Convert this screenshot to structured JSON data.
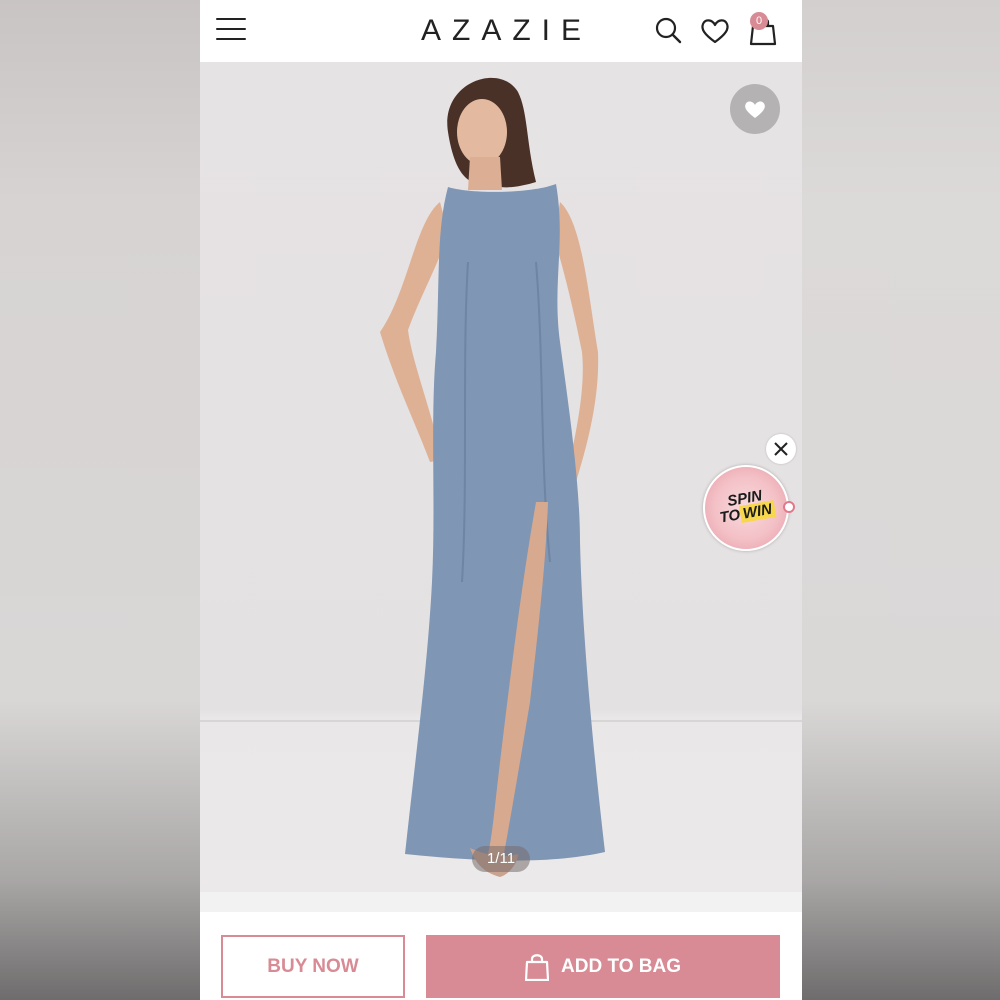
{
  "header": {
    "logo": "AZAZIE",
    "cart_count": "0"
  },
  "gallery": {
    "image_alt": "Model wearing a dusty blue sleeveless floor-length gown with high slit",
    "counter": "1/11"
  },
  "spin_widget": {
    "line1": "SPIN",
    "line2_to": "TO",
    "line2_win": "WIN"
  },
  "actions": {
    "buy_now_label": "BUY NOW",
    "add_to_bag_label": "ADD TO BAG"
  },
  "colors": {
    "accent": "#d88b94",
    "dress": "#7f96b4",
    "background": "#e5e2e3"
  },
  "icons": [
    "menu-icon",
    "search-icon",
    "heart-icon",
    "bag-icon",
    "close-icon",
    "chat-icon"
  ]
}
